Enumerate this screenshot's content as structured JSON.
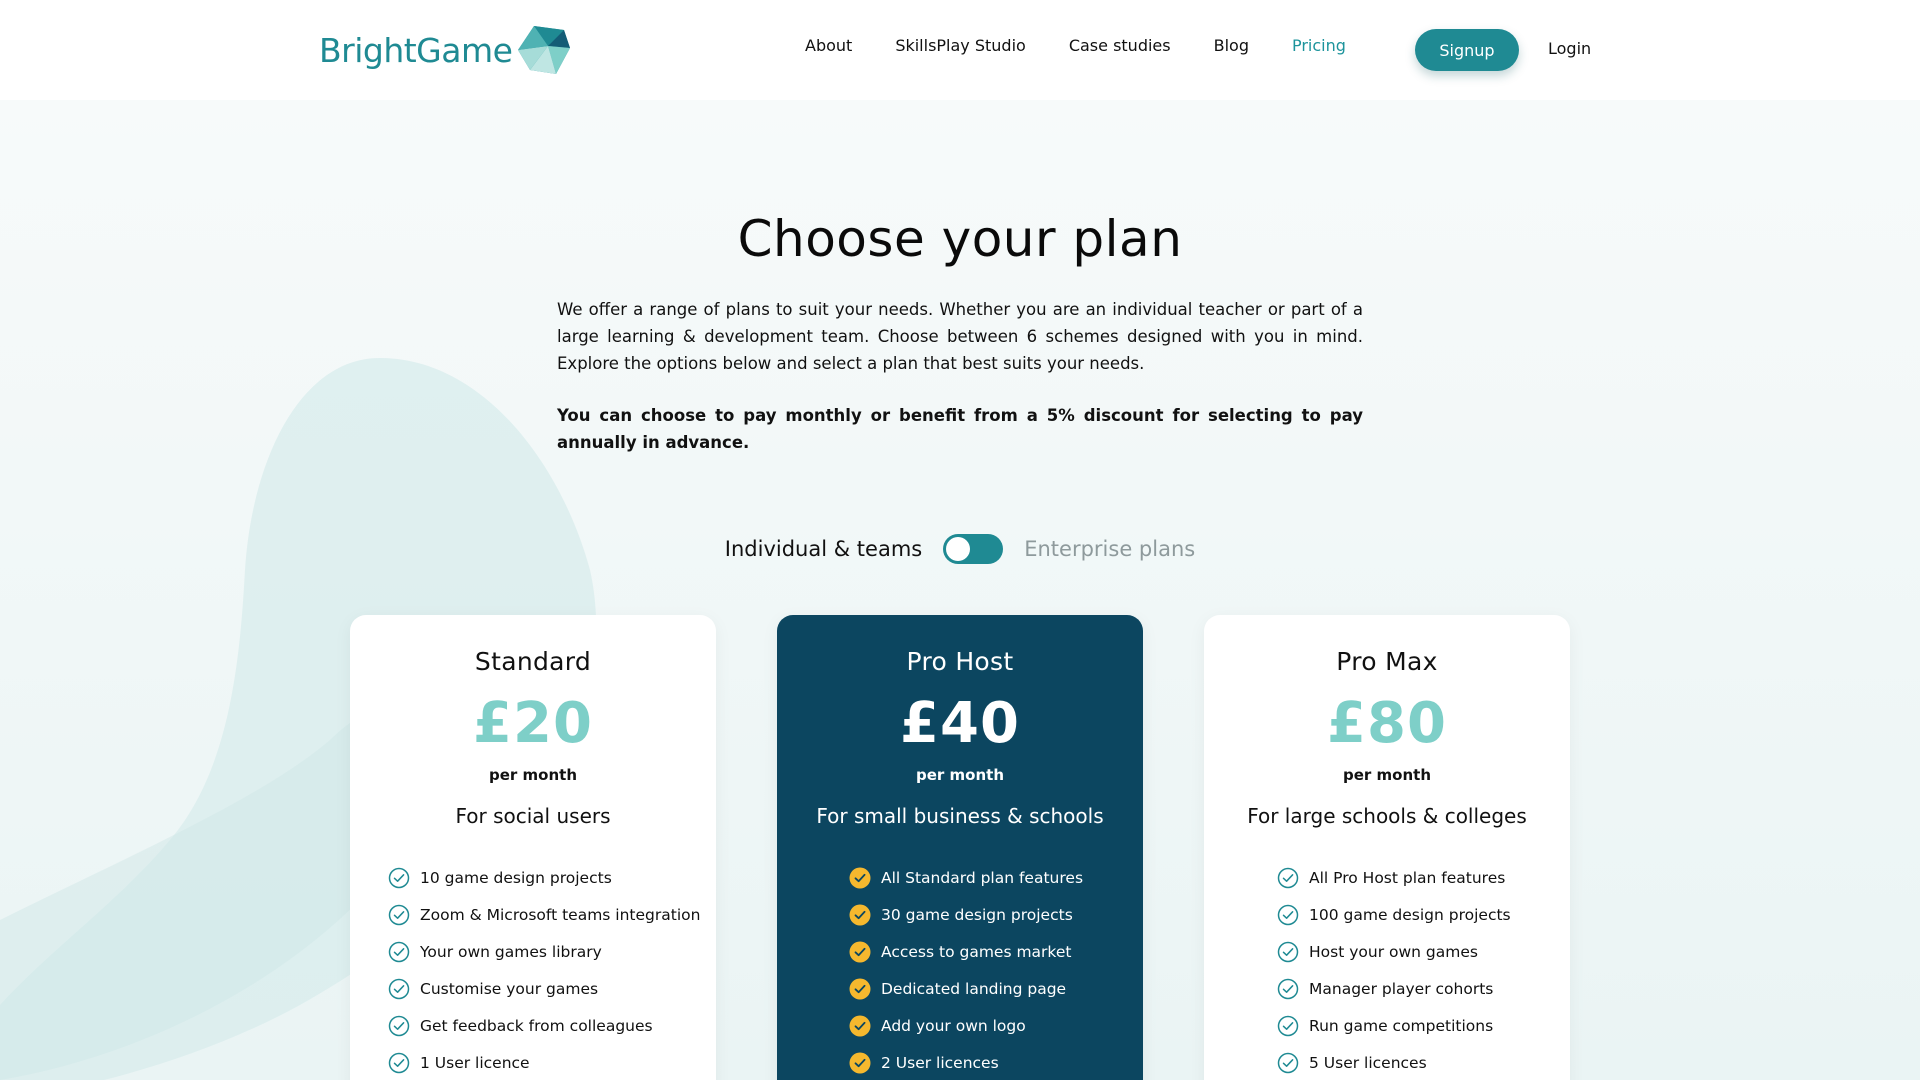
{
  "brand": {
    "name": "BrightGame",
    "teal": "#1f8a93",
    "navy": "#0c4660",
    "mint": "#7ecfc8",
    "gold": "#f5b82e"
  },
  "nav": {
    "items": [
      {
        "label": "About",
        "active": false
      },
      {
        "label": "SkillsPlay Studio",
        "active": false
      },
      {
        "label": "Case studies",
        "active": false
      },
      {
        "label": "Blog",
        "active": false
      },
      {
        "label": "Pricing",
        "active": true
      }
    ],
    "signup_label": "Signup",
    "login_label": "Login"
  },
  "hero": {
    "title": "Choose your plan",
    "intro": "We offer a range of plans to suit your needs.  Whether you are an individual teacher or part of a large learning & development team.  Choose between 6 schemes designed with you in mind.  Explore the options below and select a plan that best suits your needs.",
    "intro_bold": "You can choose to pay monthly or benefit from a 5% discount for selecting to pay annually in advance."
  },
  "toggle": {
    "left_label": "Individual & teams",
    "right_label": "Enterprise plans",
    "selected": "Individual & teams"
  },
  "plans": [
    {
      "name": "Standard",
      "price": "£20",
      "period": "per month",
      "audience": "For social users",
      "highlight": false,
      "features": [
        "10 game design projects",
        "Zoom & Microsoft teams integration",
        "Your own games library",
        "Customise your games",
        "Get feedback from colleagues",
        "1 User licence"
      ]
    },
    {
      "name": "Pro Host",
      "price": "£40",
      "period": "per month",
      "audience": "For small business & schools",
      "highlight": true,
      "features": [
        "All Standard plan features",
        "30 game design projects",
        "Access to games market",
        "Dedicated landing page",
        "Add your own logo",
        "2 User licences"
      ]
    },
    {
      "name": "Pro Max",
      "price": "£80",
      "period": "per month",
      "audience": "For large schools & colleges",
      "highlight": false,
      "features": [
        "All Pro Host plan features",
        "100 game design projects",
        "Host your own games",
        "Manager player cohorts",
        "Run game competitions",
        "5 User licences"
      ]
    }
  ],
  "icons": {
    "logo": "faceted-gem-icon",
    "feature": "check-circle-icon"
  }
}
